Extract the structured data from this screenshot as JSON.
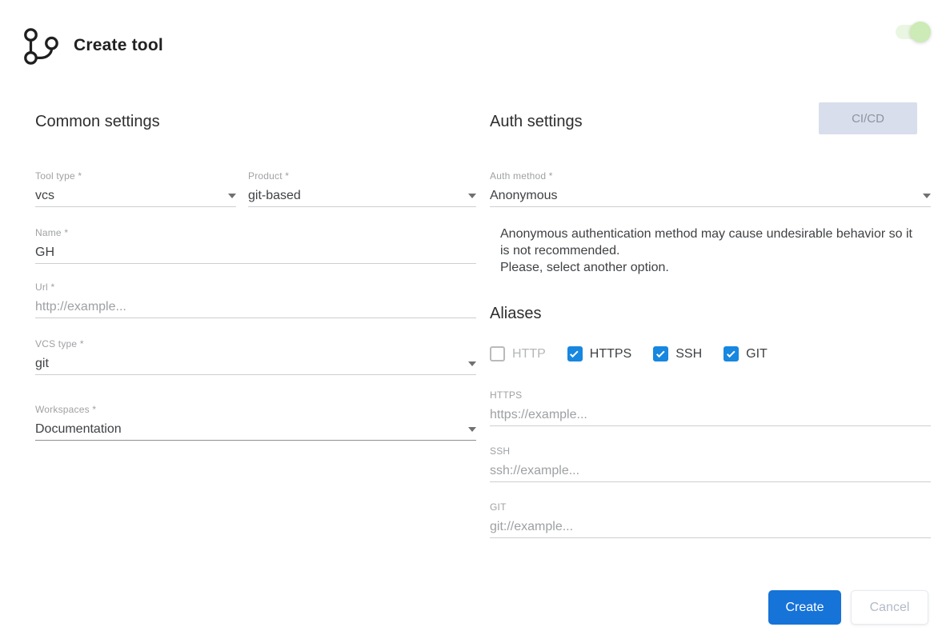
{
  "header": {
    "title": "Create tool",
    "toggle_state": "on"
  },
  "common": {
    "heading": "Common settings",
    "fields": {
      "tool_type": {
        "label": "Tool type *",
        "value": "vcs"
      },
      "product": {
        "label": "Product *",
        "value": "git-based"
      },
      "name": {
        "label": "Name *",
        "value": "GH",
        "placeholder": ""
      },
      "url": {
        "label": "Url *",
        "value": "",
        "placeholder": "http://example..."
      },
      "vcs_type": {
        "label": "VCS type *",
        "value": "git"
      },
      "workspaces": {
        "label": "Workspaces *",
        "value": "Documentation"
      }
    }
  },
  "auth": {
    "heading": "Auth settings",
    "cicd_label": "CI/CD",
    "method": {
      "label": "Auth method *",
      "value": "Anonymous"
    },
    "warning": "Anonymous authentication method may cause undesirable behavior so it is not recommended.\nPlease, select another option."
  },
  "aliases": {
    "heading": "Aliases",
    "options": [
      {
        "label": "HTTP",
        "checked": false
      },
      {
        "label": "HTTPS",
        "checked": true
      },
      {
        "label": "SSH",
        "checked": true
      },
      {
        "label": "GIT",
        "checked": true
      }
    ],
    "fields": {
      "https": {
        "label": "HTTPS",
        "placeholder": "https://example..."
      },
      "ssh": {
        "label": "SSH",
        "placeholder": "ssh://example..."
      },
      "git": {
        "label": "GIT",
        "placeholder": "git://example..."
      }
    }
  },
  "footer": {
    "create_label": "Create",
    "cancel_label": "Cancel"
  },
  "colors": {
    "accent_blue": "#1673d8",
    "checkbox_blue": "#1787e0",
    "toggle_green": "#ccebb6",
    "toggle_track": "#eaf6e1",
    "cicd_bg": "#d8deeb"
  }
}
